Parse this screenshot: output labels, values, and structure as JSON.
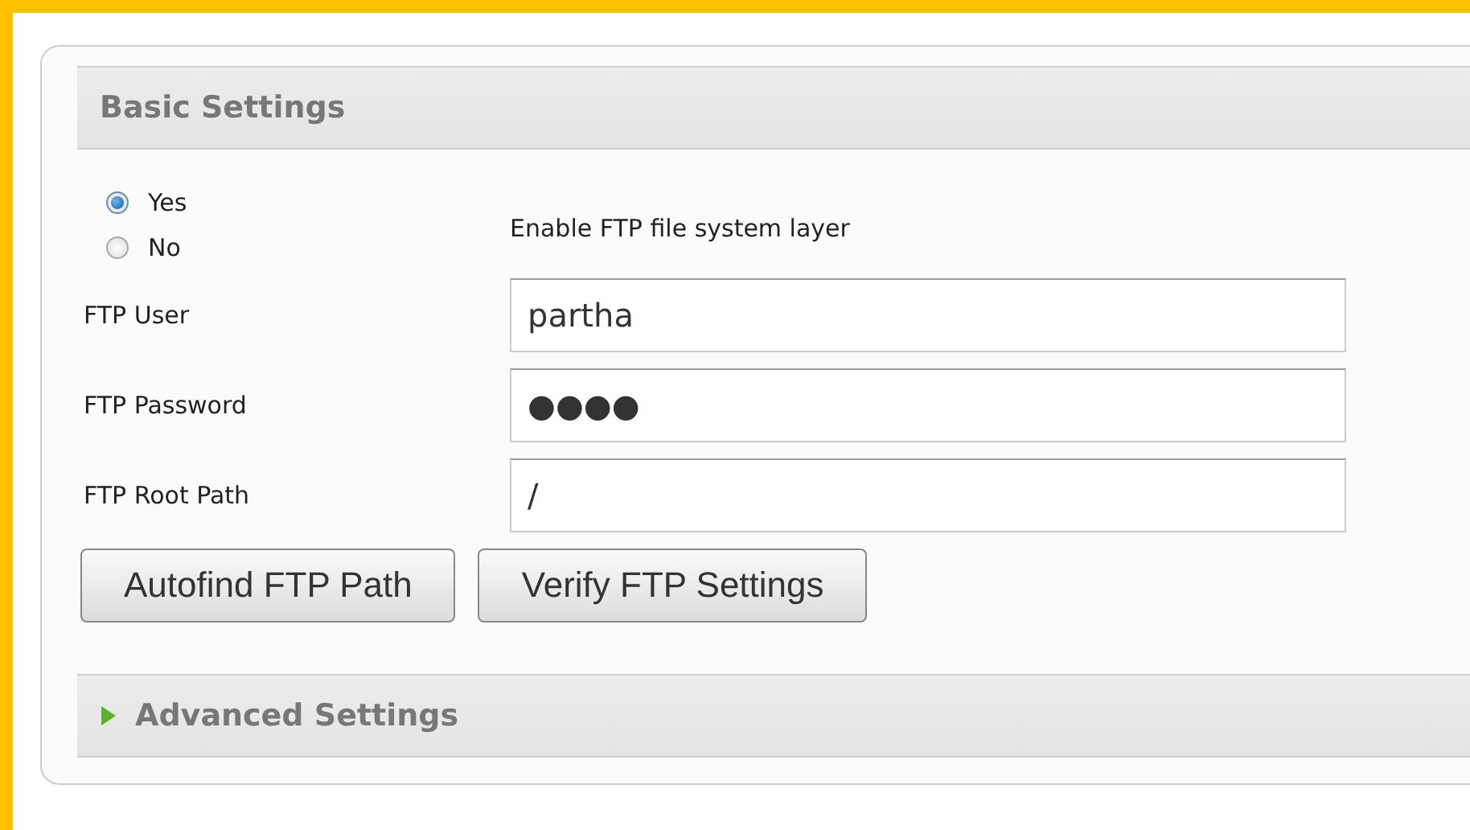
{
  "basic_settings": {
    "title": "Basic Settings",
    "enable_ftp": {
      "options": [
        {
          "label": "Yes",
          "selected": true
        },
        {
          "label": "No",
          "selected": false
        }
      ],
      "description": "Enable FTP file system layer"
    },
    "fields": [
      {
        "label": "FTP User",
        "value": "partha"
      },
      {
        "label": "FTP Password",
        "value": "●●●●"
      },
      {
        "label": "FTP Root Path",
        "value": "/"
      }
    ],
    "buttons": [
      "Autofind FTP Path",
      "Verify FTP Settings"
    ]
  },
  "advanced_settings": {
    "title": "Advanced Settings",
    "expanded": false
  }
}
